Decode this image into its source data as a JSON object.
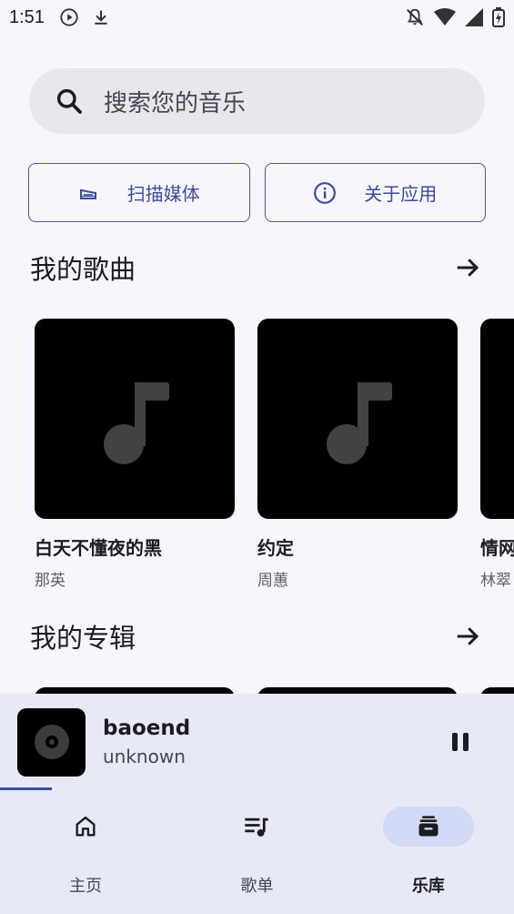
{
  "status_bar": {
    "time": "1:51",
    "left_icons": [
      "play-circle-icon",
      "download-icon"
    ],
    "right_icons": [
      "notifications-off-icon",
      "wifi-icon",
      "signal-icon",
      "battery-charging-icon"
    ]
  },
  "search": {
    "placeholder": "搜索您的音乐",
    "icon": "search-icon"
  },
  "actions": [
    {
      "label": "扫描媒体",
      "icon": "scan-media-icon"
    },
    {
      "label": "关于应用",
      "icon": "info-icon"
    }
  ],
  "my_songs": {
    "title": "我的歌曲",
    "items": [
      {
        "title": "白天不懂夜的黑",
        "artist": "那英"
      },
      {
        "title": "约定",
        "artist": "周蕙"
      },
      {
        "title": "情网",
        "artist": "林翠"
      }
    ]
  },
  "my_albums": {
    "title": "我的专辑"
  },
  "now_playing": {
    "title": "baoend",
    "artist": "unknown",
    "progress": 0.1,
    "state_icon": "pause-icon"
  },
  "bottom_nav": {
    "items": [
      {
        "label": "主页",
        "icon": "home-icon",
        "active": false
      },
      {
        "label": "歌单",
        "icon": "playlist-icon",
        "active": false
      },
      {
        "label": "乐库",
        "icon": "library-icon",
        "active": true
      }
    ]
  },
  "colors": {
    "background": "#f7f6fc",
    "accent": "#3a4ba0",
    "player_bg": "#e7e9f6",
    "active_pill": "#d2d9f4"
  }
}
